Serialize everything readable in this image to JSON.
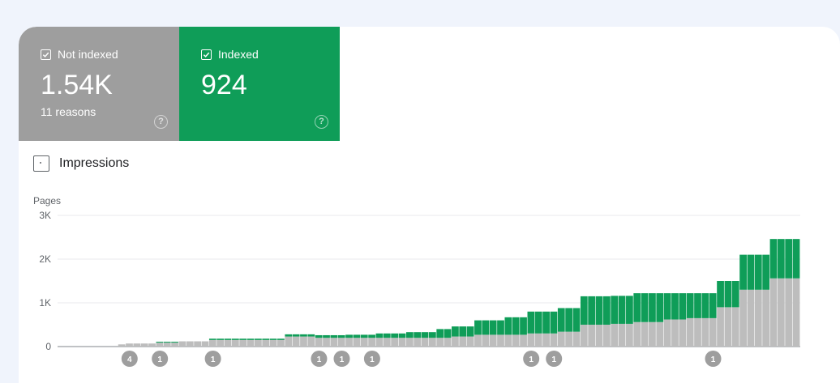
{
  "tiles": {
    "not_indexed": {
      "label": "Not indexed",
      "value": "1.54K",
      "sub": "11 reasons",
      "help": "?"
    },
    "indexed": {
      "label": "Indexed",
      "value": "924",
      "help": "?"
    }
  },
  "impressions": {
    "label": "Impressions"
  },
  "colors": {
    "not_indexed": "#bdbdbd",
    "indexed": "#0f9d58"
  },
  "chart_data": {
    "type": "bar",
    "stacked": true,
    "ylabel": "Pages",
    "ylim": [
      0,
      3000
    ],
    "yticks": [
      "0",
      "1K",
      "2K",
      "3K"
    ],
    "grid": true,
    "categories": [],
    "series": [
      {
        "name": "Not indexed",
        "values": [
          0,
          0,
          0,
          0,
          0,
          0,
          0,
          0,
          50,
          70,
          70,
          70,
          70,
          90,
          90,
          90,
          120,
          120,
          120,
          120,
          150,
          150,
          150,
          150,
          150,
          150,
          150,
          150,
          150,
          150,
          230,
          230,
          230,
          230,
          200,
          200,
          200,
          200,
          200,
          200,
          200,
          200,
          200,
          200,
          200,
          200,
          200,
          200,
          200,
          200,
          200,
          200,
          230,
          230,
          230,
          270,
          270,
          270,
          270,
          270,
          270,
          270,
          300,
          300,
          300,
          300,
          340,
          340,
          340,
          500,
          500,
          500,
          500,
          520,
          520,
          520,
          560,
          560,
          560,
          560,
          620,
          620,
          620,
          650,
          650,
          650,
          650,
          900,
          900,
          900,
          1300,
          1300,
          1300,
          1300,
          1560,
          1560,
          1560,
          1560
        ],
        "color_key": "not_indexed"
      },
      {
        "name": "Indexed",
        "values": [
          0,
          0,
          0,
          0,
          0,
          0,
          0,
          0,
          0,
          0,
          0,
          0,
          0,
          20,
          20,
          20,
          0,
          0,
          0,
          0,
          30,
          30,
          30,
          30,
          30,
          30,
          30,
          30,
          30,
          30,
          50,
          50,
          50,
          50,
          60,
          60,
          60,
          60,
          70,
          70,
          70,
          70,
          100,
          100,
          100,
          100,
          130,
          130,
          130,
          130,
          200,
          200,
          230,
          230,
          230,
          330,
          330,
          330,
          330,
          400,
          400,
          400,
          500,
          500,
          500,
          500,
          540,
          540,
          540,
          650,
          650,
          650,
          650,
          640,
          640,
          640,
          660,
          660,
          660,
          660,
          600,
          600,
          600,
          570,
          570,
          570,
          570,
          600,
          600,
          600,
          800,
          800,
          800,
          800,
          900,
          900,
          900,
          900
        ],
        "color_key": "indexed"
      }
    ],
    "markers": [
      {
        "label": "4",
        "index": 9
      },
      {
        "label": "1",
        "index": 13
      },
      {
        "label": "1",
        "index": 20
      },
      {
        "label": "1",
        "index": 34
      },
      {
        "label": "1",
        "index": 37
      },
      {
        "label": "1",
        "index": 41
      },
      {
        "label": "1",
        "index": 62
      },
      {
        "label": "1",
        "index": 65
      },
      {
        "label": "1",
        "index": 86
      }
    ]
  }
}
